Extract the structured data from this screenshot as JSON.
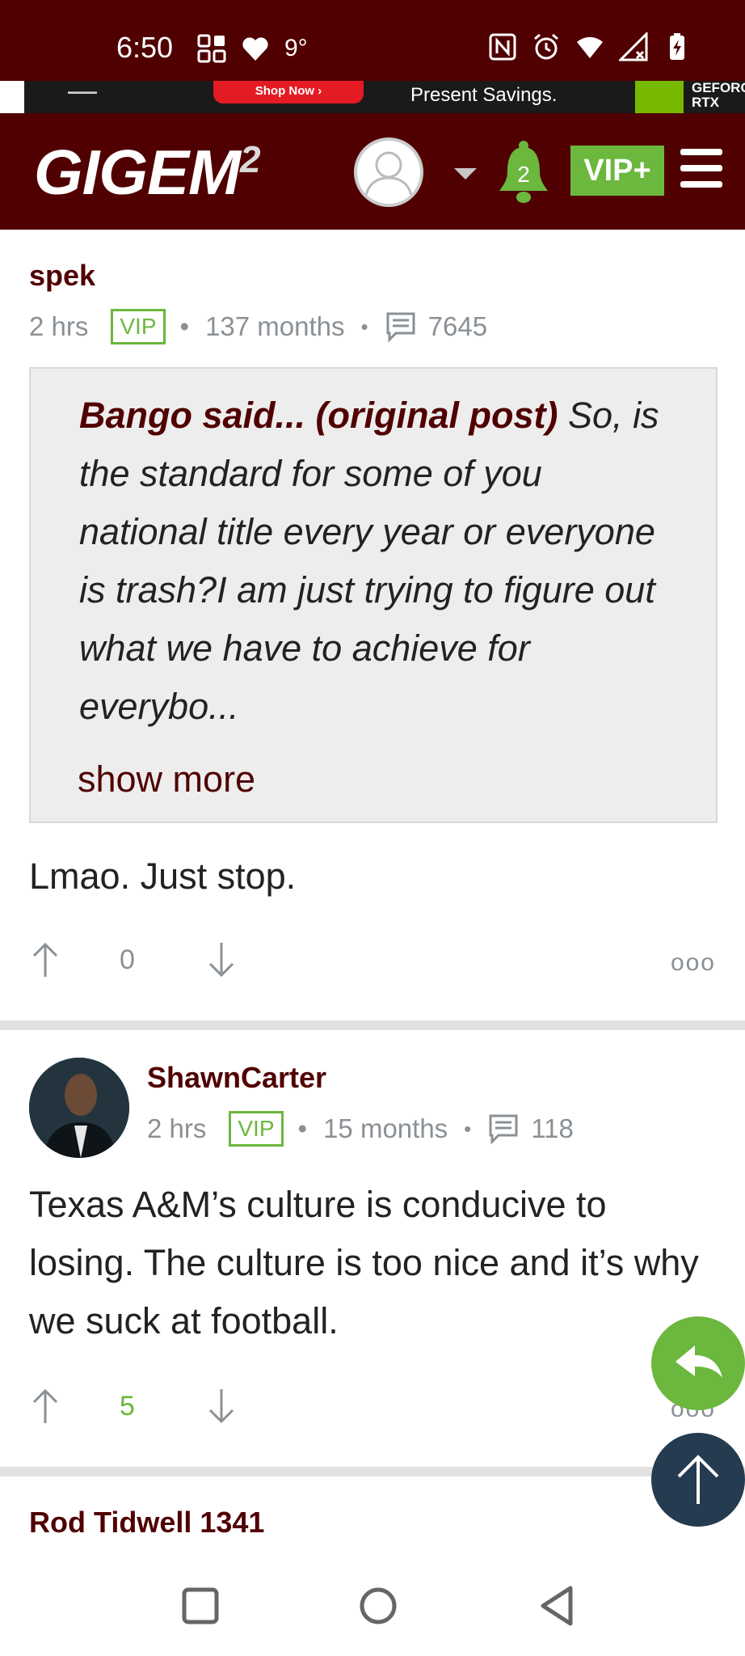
{
  "status_bar": {
    "time": "6:50",
    "temperature": "9°",
    "left_icons": [
      "grid-app-icon",
      "heart-icon"
    ],
    "right_icons": [
      "nfc-icon",
      "alarm-icon",
      "wifi-icon",
      "signal-icon",
      "battery-icon"
    ]
  },
  "ad": {
    "cta_label": "Shop Now ›",
    "text": "Present Savings.",
    "brand_line1": "GEFORCE",
    "brand_line2": "RTX"
  },
  "header": {
    "logo_text": "GIGEM",
    "logo_sup": "2",
    "notification_count": "2",
    "vip_label": "VIP+"
  },
  "posts": [
    {
      "author": "spek",
      "time": "2 hrs",
      "badge": "VIP",
      "tenure": "137 months",
      "post_count": "7645",
      "quote": {
        "attribution": "Bango said... (original post)",
        "text": " So, is the standard for some of you national title every year or everyone is trash?I am just trying to figure out what we have to achieve for everybo...",
        "show_more": "show more"
      },
      "body": "Lmao. Just stop.",
      "votes": "0"
    },
    {
      "author": "ShawnCarter",
      "time": "2 hrs",
      "badge": "VIP",
      "tenure": "15 months",
      "post_count": "118",
      "body": "Texas A&M’s culture is conducive to losing. The culture is too nice and it’s why we suck at football.",
      "votes": "5"
    },
    {
      "author": "Rod Tidwell 1341"
    }
  ],
  "more_label": "ooo",
  "colors": {
    "maroon": "#500000",
    "green": "#6cb73e",
    "navy": "#243b50",
    "meta_gray": "#8a9095"
  }
}
